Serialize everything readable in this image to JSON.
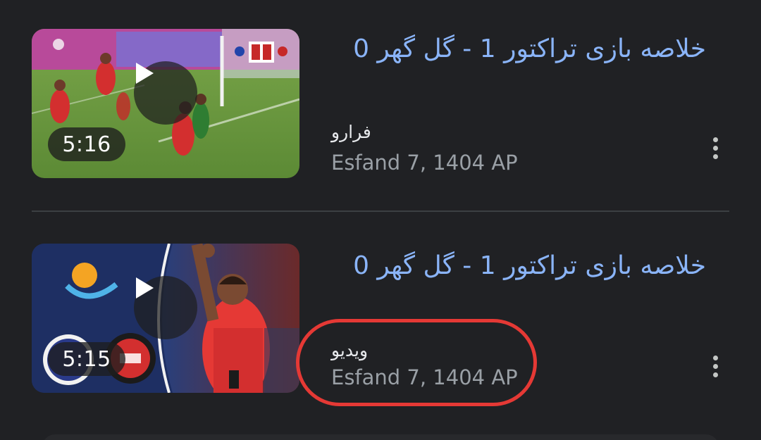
{
  "results": [
    {
      "title": "خلاصه بازی تراکتور 1 - گل گهر 0",
      "source": "فرارو",
      "date": "Esfand 7, 1404 AP",
      "duration": "5:16",
      "thumbnail_icon": "soccer-match-thumbnail",
      "play_icon": "play-icon",
      "menu_icon": "more-vert-icon"
    },
    {
      "title": "خلاصه بازی تراکتور 1 - گل گهر 0",
      "source": "ویدیو",
      "date": "Esfand 7, 1404 AP",
      "duration": "5:15",
      "thumbnail_icon": "soccer-player-thumbnail",
      "play_icon": "play-icon",
      "menu_icon": "more-vert-icon"
    }
  ],
  "colors": {
    "background": "#202124",
    "title_link": "#8ab4f8",
    "source_text": "#e8eaed",
    "date_text": "#9aa0a6",
    "highlight_ring": "#e53935"
  }
}
